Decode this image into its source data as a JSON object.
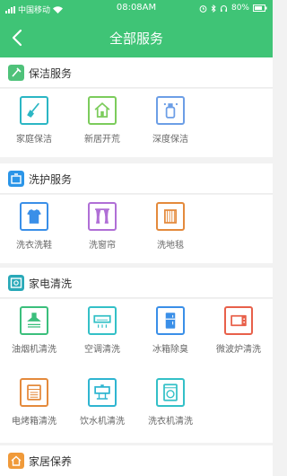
{
  "status_bar": {
    "carrier": "中国移动",
    "time": "08:08AM",
    "battery": "80%"
  },
  "nav": {
    "title": "全部服务"
  },
  "sections": [
    {
      "title": "保洁服务",
      "icon_color": "#4fc27a",
      "items": [
        {
          "label": "家庭保洁",
          "icon": "broom-icon",
          "color": "#2bb6c4"
        },
        {
          "label": "新居开荒",
          "icon": "house-icon",
          "color": "#7ccc5c"
        },
        {
          "label": "深度保洁",
          "icon": "spray-bottle-icon",
          "color": "#6c9ee6"
        }
      ]
    },
    {
      "title": "洗护服务",
      "icon_color": "#2b95e8",
      "items": [
        {
          "label": "洗衣洗鞋",
          "icon": "shirt-icon",
          "color": "#3a8fe8"
        },
        {
          "label": "洗窗帘",
          "icon": "curtain-icon",
          "color": "#b06fd6"
        },
        {
          "label": "洗地毯",
          "icon": "carpet-icon",
          "color": "#e48a3c"
        }
      ]
    },
    {
      "title": "家电清洗",
      "icon_color": "#29a9b8",
      "items": [
        {
          "label": "油烟机清洗",
          "icon": "range-hood-icon",
          "color": "#3bbf7c"
        },
        {
          "label": "空调清洗",
          "icon": "air-conditioner-icon",
          "color": "#33c0c7"
        },
        {
          "label": "冰箱除臭",
          "icon": "fridge-icon",
          "color": "#3a8fe8"
        },
        {
          "label": "微波炉清洗",
          "icon": "microwave-icon",
          "color": "#e8604a"
        },
        {
          "label": "电烤箱清洗",
          "icon": "oven-icon",
          "color": "#e48a3c"
        },
        {
          "label": "饮水机清洗",
          "icon": "water-dispenser-icon",
          "color": "#2fb5d1"
        },
        {
          "label": "洗衣机清洗",
          "icon": "washing-machine-icon",
          "color": "#33c0c7"
        }
      ]
    },
    {
      "title": "家居保养",
      "icon_color": "#f09a3a",
      "items": []
    }
  ]
}
